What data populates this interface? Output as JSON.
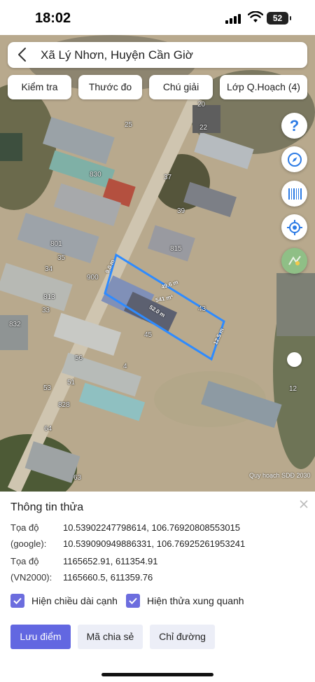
{
  "status": {
    "time": "18:02",
    "battery": "52"
  },
  "header": {
    "title": "Xã Lý Nhơn, Huyện Cần Giờ"
  },
  "tabs": [
    "Kiểm tra",
    "Thước đo",
    "Chú giải",
    "Lớp Q.Hoạch (4)"
  ],
  "map": {
    "watermark": "Quy hoạch SDĐ 2030",
    "parcel": {
      "area": "541 m²",
      "edge_top": "49.6 m",
      "edge_bottom": "52.0 m",
      "edge_left": "9.0 m",
      "edge_right": "12.5 m",
      "stroke_color": "#2e8bff"
    },
    "labels": [
      "20",
      "25",
      "22",
      "830",
      "37",
      "39",
      "815",
      "801",
      "35",
      "34",
      "900",
      "43",
      "813",
      "33",
      "832",
      "45",
      "56",
      "4",
      "51",
      "53",
      "828",
      "64",
      "63",
      "12"
    ]
  },
  "map_buttons": [
    "help-icon",
    "compass-icon",
    "barcode-icon",
    "locate-icon",
    "layers-icon"
  ],
  "info": {
    "title": "Thông tin thửa",
    "rows": [
      {
        "label": "Tọa độ",
        "value": "10.53902247798614, 106.76920808553015"
      },
      {
        "label": "(google):",
        "value": "10.539090949886331, 106.76925261953241"
      },
      {
        "label": "Tọa độ",
        "value": "1165652.91, 611354.91"
      },
      {
        "label": "(VN2000):",
        "value": "1165660.5, 611359.76"
      }
    ],
    "checkboxes": [
      {
        "label": "Hiện chiều dài cạnh",
        "checked": true
      },
      {
        "label": "Hiện thửa xung quanh",
        "checked": true
      }
    ],
    "buttons": {
      "save": "Lưu điểm",
      "share": "Mã chia sẻ",
      "directions": "Chỉ đường"
    }
  },
  "colors": {
    "accent": "#6267e1",
    "checkbox": "#6c6dde"
  }
}
